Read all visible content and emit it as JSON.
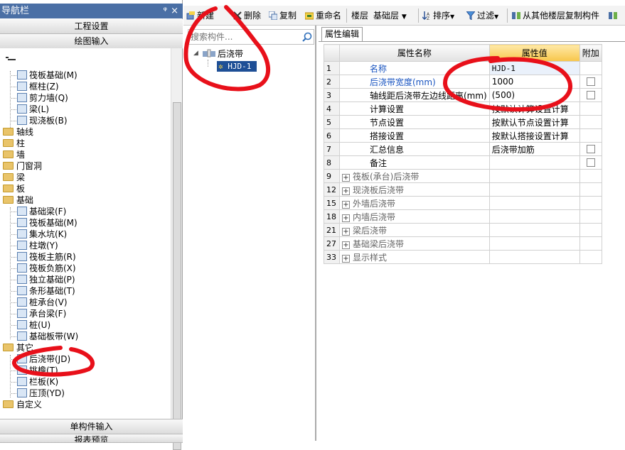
{
  "nav": {
    "title": "导航栏",
    "pin": "ᵠ",
    "close": "×",
    "btn_project": "工程设置",
    "btn_draw": "绘图输入",
    "btn_single": "单构件输入",
    "btn_bottom": "报表预览",
    "tree": [
      {
        "label": "筏板基础(M)",
        "indent": 24,
        "type": "item"
      },
      {
        "label": "框柱(Z)",
        "indent": 24,
        "type": "item"
      },
      {
        "label": "剪力墙(Q)",
        "indent": 24,
        "type": "item"
      },
      {
        "label": "梁(L)",
        "indent": 24,
        "type": "item"
      },
      {
        "label": "现浇板(B)",
        "indent": 24,
        "type": "item"
      },
      {
        "label": "轴线",
        "indent": 4,
        "type": "folder"
      },
      {
        "label": "柱",
        "indent": 4,
        "type": "folder"
      },
      {
        "label": "墙",
        "indent": 4,
        "type": "folder"
      },
      {
        "label": "门窗洞",
        "indent": 4,
        "type": "folder"
      },
      {
        "label": "梁",
        "indent": 4,
        "type": "folder"
      },
      {
        "label": "板",
        "indent": 4,
        "type": "folder"
      },
      {
        "label": "基础",
        "indent": 4,
        "type": "folder"
      },
      {
        "label": "基础梁(F)",
        "indent": 24,
        "type": "item"
      },
      {
        "label": "筏板基础(M)",
        "indent": 24,
        "type": "item"
      },
      {
        "label": "集水坑(K)",
        "indent": 24,
        "type": "item"
      },
      {
        "label": "柱墩(Y)",
        "indent": 24,
        "type": "item"
      },
      {
        "label": "筏板主筋(R)",
        "indent": 24,
        "type": "item"
      },
      {
        "label": "筏板负筋(X)",
        "indent": 24,
        "type": "item"
      },
      {
        "label": "独立基础(P)",
        "indent": 24,
        "type": "item"
      },
      {
        "label": "条形基础(T)",
        "indent": 24,
        "type": "item"
      },
      {
        "label": "桩承台(V)",
        "indent": 24,
        "type": "item"
      },
      {
        "label": "承台梁(F)",
        "indent": 24,
        "type": "item"
      },
      {
        "label": "桩(U)",
        "indent": 24,
        "type": "item"
      },
      {
        "label": "基础板带(W)",
        "indent": 24,
        "type": "item"
      },
      {
        "label": "其它",
        "indent": 4,
        "type": "folder"
      },
      {
        "label": "后浇带(JD)",
        "indent": 24,
        "type": "item"
      },
      {
        "label": "挑檐(T)",
        "indent": 24,
        "type": "item"
      },
      {
        "label": "栏板(K)",
        "indent": 24,
        "type": "item"
      },
      {
        "label": "压顶(YD)",
        "indent": 24,
        "type": "item"
      },
      {
        "label": "自定义",
        "indent": 4,
        "type": "folder"
      }
    ]
  },
  "toolbar": {
    "new": "新建",
    "delete": "删除",
    "copy": "复制",
    "rename": "重命名",
    "floor_label": "楼层",
    "floor_value": "基础层",
    "sort": "排序",
    "filter": "过滤",
    "copy_from": "从其他楼层复制构件"
  },
  "middle": {
    "search_placeholder": "搜索构件...",
    "root": "后浇带",
    "child": "HJD-1"
  },
  "props": {
    "tab": "属性编辑",
    "col_name": "属性名称",
    "col_value": "属性值",
    "col_extra": "附加",
    "rows": [
      {
        "n": "1",
        "name": "名称",
        "value": "HJD-1",
        "blue": true,
        "chk": false,
        "exp": false
      },
      {
        "n": "2",
        "name": "后浇带宽度(mm)",
        "value": "1000",
        "blue": true,
        "chk": true,
        "exp": false
      },
      {
        "n": "3",
        "name": "轴线距后浇带左边线距离(mm)",
        "value": "(500)",
        "blue": false,
        "chk": true,
        "exp": false
      },
      {
        "n": "4",
        "name": "计算设置",
        "value": "按默认计算设置计算",
        "blue": false,
        "chk": false,
        "exp": false
      },
      {
        "n": "5",
        "name": "节点设置",
        "value": "按默认节点设置计算",
        "blue": false,
        "chk": false,
        "exp": false
      },
      {
        "n": "6",
        "name": "搭接设置",
        "value": "按默认搭接设置计算",
        "blue": false,
        "chk": false,
        "exp": false
      },
      {
        "n": "7",
        "name": "汇总信息",
        "value": "后浇带加筋",
        "blue": false,
        "chk": true,
        "exp": false
      },
      {
        "n": "8",
        "name": "备注",
        "value": "",
        "blue": false,
        "chk": true,
        "exp": false
      },
      {
        "n": "9",
        "name": "筏板(承台)后浇带",
        "value": "",
        "blue": false,
        "chk": false,
        "exp": true
      },
      {
        "n": "12",
        "name": "现浇板后浇带",
        "value": "",
        "blue": false,
        "chk": false,
        "exp": true
      },
      {
        "n": "15",
        "name": "外墙后浇带",
        "value": "",
        "blue": false,
        "chk": false,
        "exp": true
      },
      {
        "n": "18",
        "name": "内墙后浇带",
        "value": "",
        "blue": false,
        "chk": false,
        "exp": true
      },
      {
        "n": "21",
        "name": "梁后浇带",
        "value": "",
        "blue": false,
        "chk": false,
        "exp": true
      },
      {
        "n": "27",
        "name": "基础梁后浇带",
        "value": "",
        "blue": false,
        "chk": false,
        "exp": true
      },
      {
        "n": "33",
        "name": "显示样式",
        "value": "",
        "blue": false,
        "chk": false,
        "exp": true
      }
    ]
  },
  "colors": {
    "annotation": "#e8101a",
    "header_highlight": "#f7c64a",
    "nav_title": "#4a6fa5"
  }
}
